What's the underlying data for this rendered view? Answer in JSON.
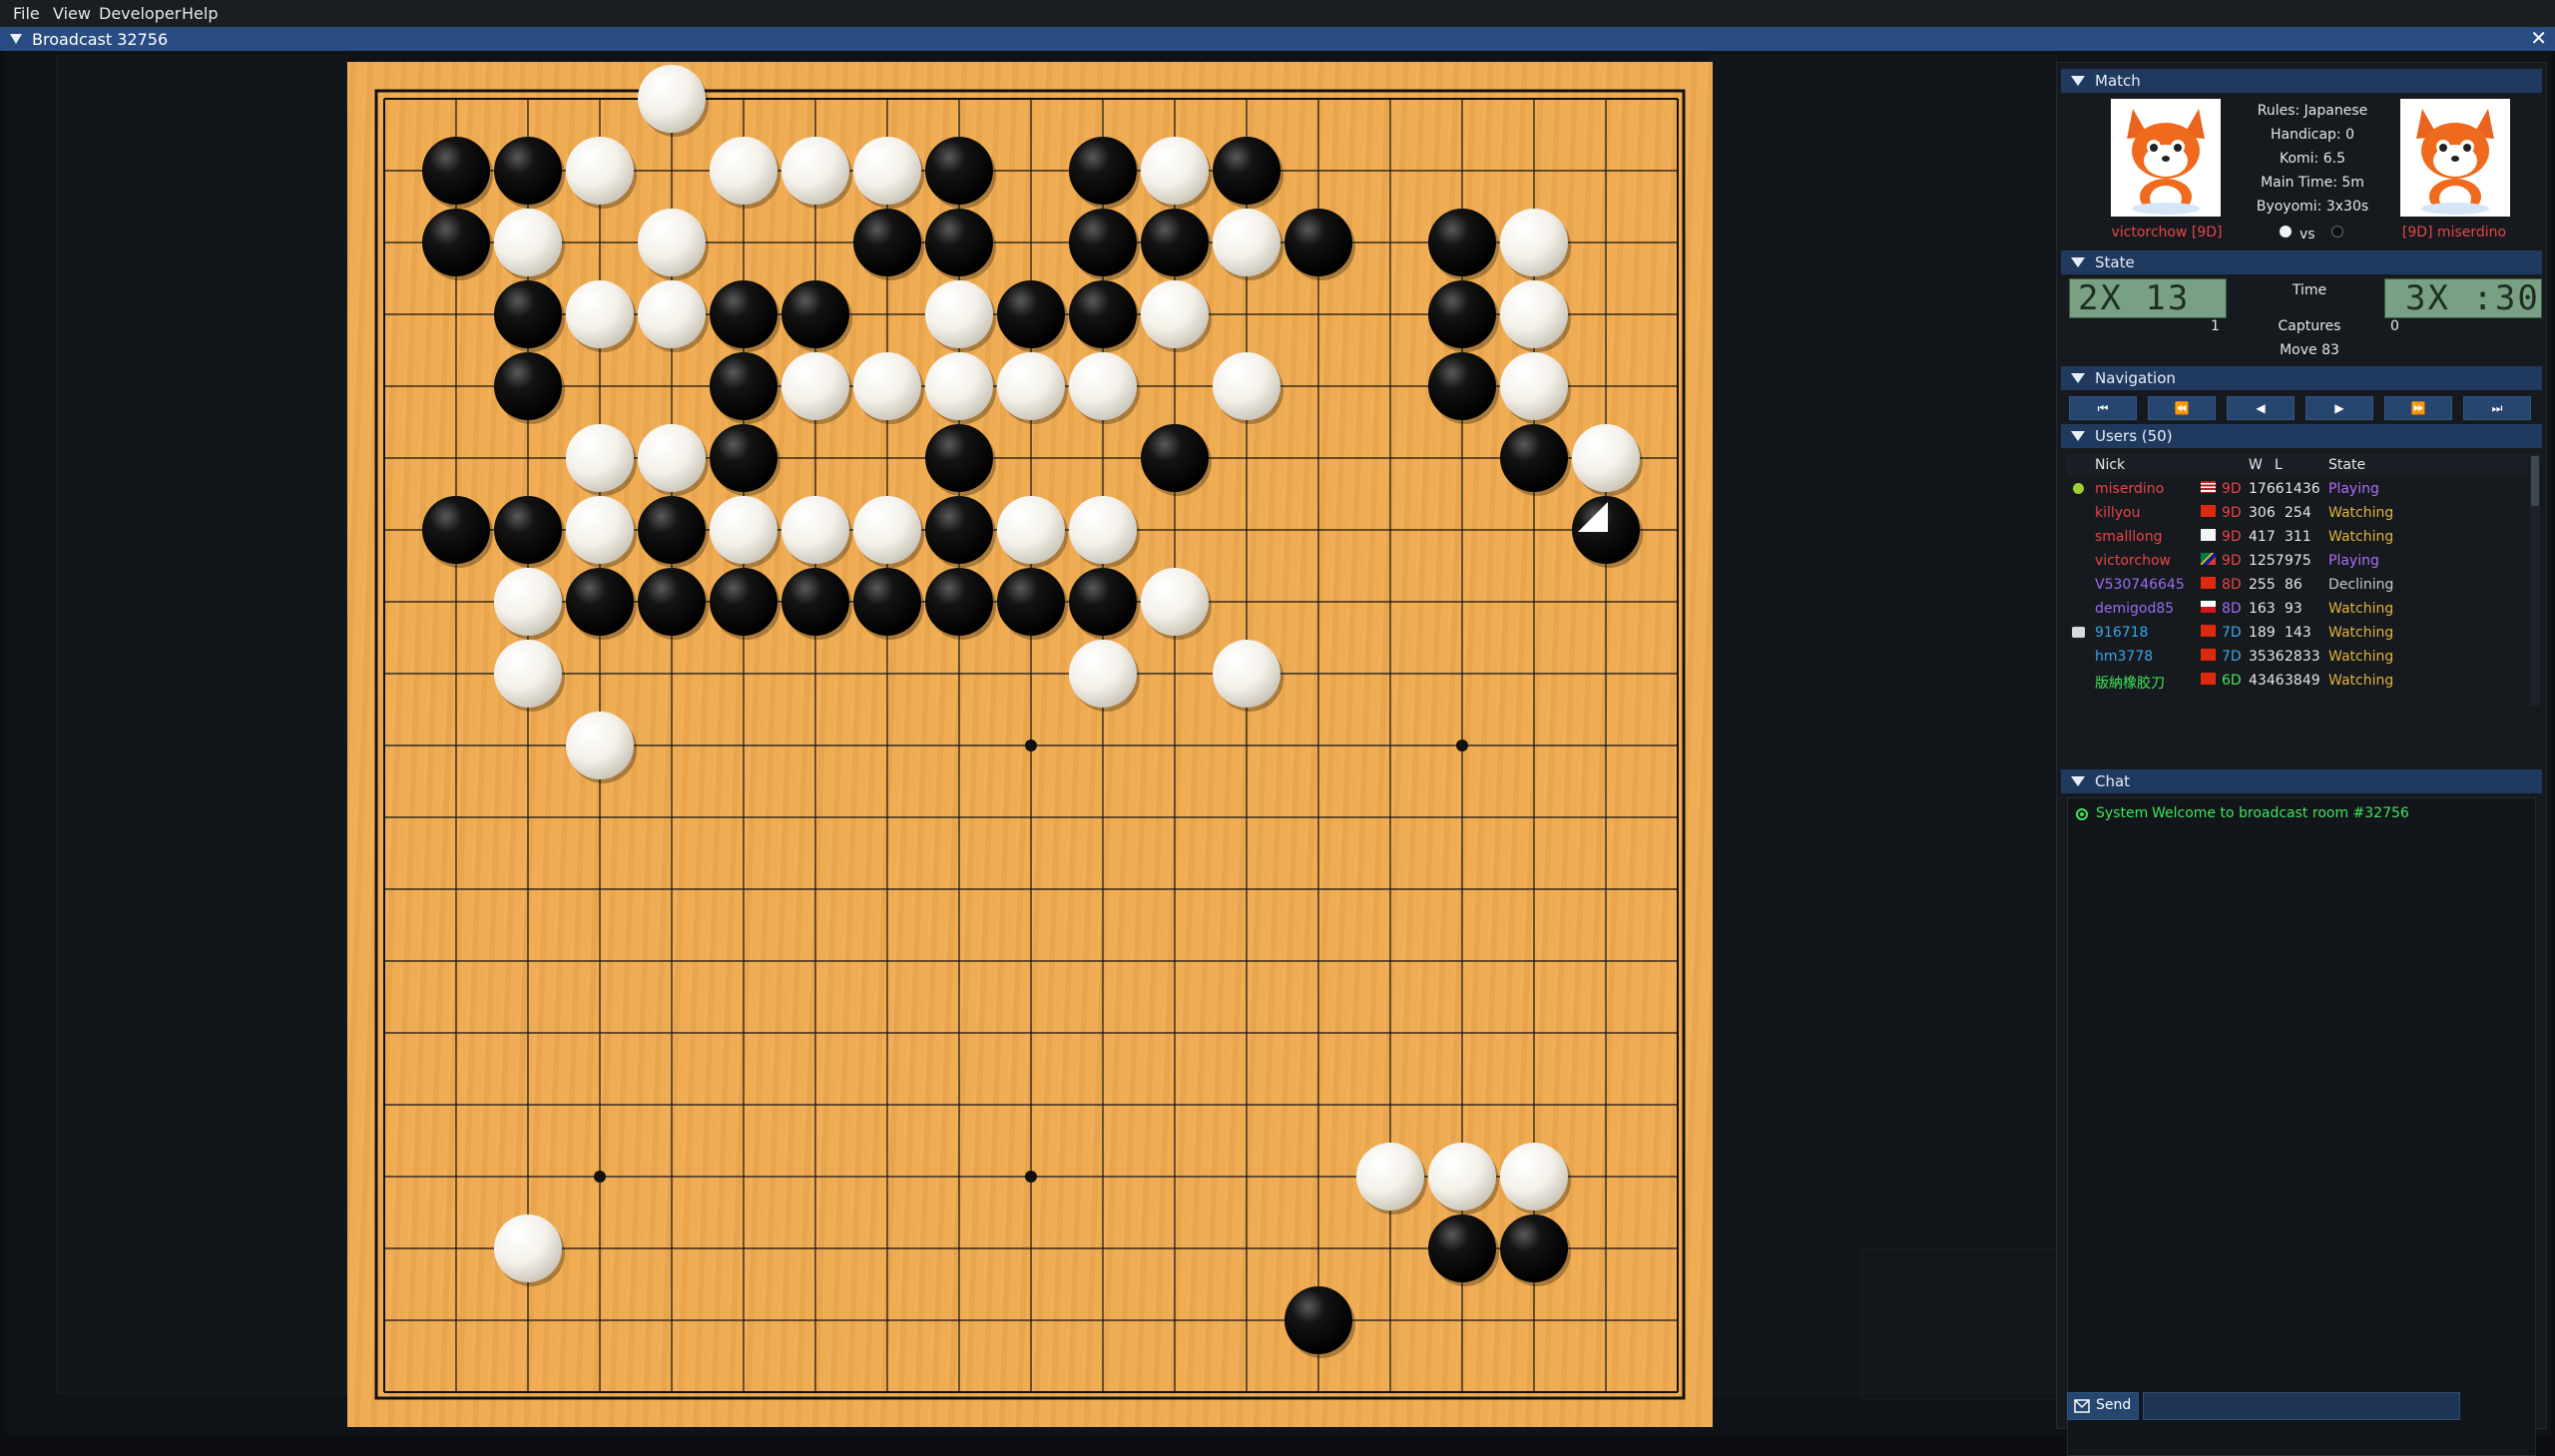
{
  "menu": {
    "items": [
      "File",
      "View",
      "Developer",
      "Help"
    ]
  },
  "window": {
    "title": "Broadcast 32756",
    "close_glyph": "✕"
  },
  "colors": {
    "board": "#efaa50",
    "accent": "#203a5f",
    "red_name": "#e84545",
    "rank_red": "#e84545",
    "purple": "#9b6df0",
    "watching": "#e0b33a",
    "playing": "#b06cf5",
    "system": "#3ee65a"
  },
  "board": {
    "size": 19,
    "hoshi": [
      [
        9,
        9
      ],
      [
        15,
        9
      ],
      [
        3,
        15
      ],
      [
        9,
        15
      ]
    ],
    "black": [
      [
        1,
        1
      ],
      [
        2,
        1
      ],
      [
        8,
        1
      ],
      [
        10,
        1
      ],
      [
        12,
        1
      ],
      [
        1,
        2
      ],
      [
        7,
        2
      ],
      [
        8,
        2
      ],
      [
        10,
        2
      ],
      [
        11,
        2
      ],
      [
        13,
        2
      ],
      [
        15,
        2
      ],
      [
        2,
        3
      ],
      [
        5,
        3
      ],
      [
        6,
        3
      ],
      [
        9,
        3
      ],
      [
        10,
        3
      ],
      [
        15,
        3
      ],
      [
        2,
        4
      ],
      [
        5,
        4
      ],
      [
        15,
        4
      ],
      [
        5,
        5
      ],
      [
        8,
        5
      ],
      [
        11,
        5
      ],
      [
        16,
        5
      ],
      [
        1,
        6
      ],
      [
        2,
        6
      ],
      [
        4,
        6
      ],
      [
        8,
        6
      ],
      [
        17,
        6
      ],
      [
        3,
        7
      ],
      [
        4,
        7
      ],
      [
        5,
        7
      ],
      [
        6,
        7
      ],
      [
        7,
        7
      ],
      [
        8,
        7
      ],
      [
        9,
        7
      ],
      [
        10,
        7
      ],
      [
        15,
        16
      ],
      [
        16,
        16
      ],
      [
        13,
        17
      ]
    ],
    "white": [
      [
        4,
        0
      ],
      [
        3,
        1
      ],
      [
        5,
        1
      ],
      [
        6,
        1
      ],
      [
        7,
        1
      ],
      [
        11,
        1
      ],
      [
        2,
        2
      ],
      [
        4,
        2
      ],
      [
        12,
        2
      ],
      [
        16,
        2
      ],
      [
        3,
        3
      ],
      [
        4,
        3
      ],
      [
        8,
        3
      ],
      [
        11,
        3
      ],
      [
        16,
        3
      ],
      [
        6,
        4
      ],
      [
        7,
        4
      ],
      [
        8,
        4
      ],
      [
        9,
        4
      ],
      [
        10,
        4
      ],
      [
        12,
        4
      ],
      [
        16,
        4
      ],
      [
        3,
        5
      ],
      [
        4,
        5
      ],
      [
        17,
        5
      ],
      [
        3,
        6
      ],
      [
        5,
        6
      ],
      [
        6,
        6
      ],
      [
        7,
        6
      ],
      [
        9,
        6
      ],
      [
        10,
        6
      ],
      [
        2,
        7
      ],
      [
        11,
        7
      ],
      [
        2,
        8
      ],
      [
        10,
        8
      ],
      [
        12,
        8
      ],
      [
        3,
        9
      ],
      [
        14,
        15
      ],
      [
        15,
        15
      ],
      [
        16,
        15
      ],
      [
        2,
        16
      ]
    ],
    "last_move": [
      17,
      6
    ]
  },
  "match": {
    "section_label": "Match",
    "rules": "Rules: Japanese",
    "handicap": "Handicap: 0",
    "komi": "Komi: 6.5",
    "main_time": "Main Time: 5m",
    "byoyomi": "Byoyomi: 3x30s",
    "left_player": "victorchow [9D]",
    "right_player": "[9D] miserdino",
    "vs": "vs"
  },
  "state": {
    "section_label": "State",
    "clock_left": "2X 13",
    "clock_right": "3X :30",
    "time_label": "Time",
    "captures_label": "Captures",
    "captures_left": "1",
    "captures_right": "0",
    "move_label": "Move 83"
  },
  "navigation": {
    "section_label": "Navigation",
    "buttons": [
      {
        "name": "first-move-button",
        "glyph": "⏮"
      },
      {
        "name": "rewind-button",
        "glyph": "⏪"
      },
      {
        "name": "previous-move-button",
        "glyph": "◀"
      },
      {
        "name": "next-move-button",
        "glyph": "▶"
      },
      {
        "name": "fast-forward-button",
        "glyph": "⏩"
      },
      {
        "name": "last-move-button",
        "glyph": "⏭"
      }
    ]
  },
  "users": {
    "section_label": "Users (50)",
    "columns": {
      "nick": "Nick",
      "w": "W",
      "l": "L",
      "state": "State"
    },
    "rows": [
      {
        "nick": "miserdino",
        "rank": "9D",
        "w": "1766",
        "l": "1436",
        "state": "Playing",
        "nick_color": "#e84545",
        "rank_color": "#e84545",
        "state_color": "#b06cf5",
        "flag": "us",
        "icon": "green"
      },
      {
        "nick": "killyou",
        "rank": "9D",
        "w": "306",
        "l": "254",
        "state": "Watching",
        "nick_color": "#e84545",
        "rank_color": "#e84545",
        "state_color": "#e0b33a",
        "flag": "cn",
        "icon": ""
      },
      {
        "nick": "smalllong",
        "rank": "9D",
        "w": "417",
        "l": "311",
        "state": "Watching",
        "nick_color": "#e84545",
        "rank_color": "#e84545",
        "state_color": "#e0b33a",
        "flag": "kr",
        "icon": ""
      },
      {
        "nick": "victorchow",
        "rank": "9D",
        "w": "1257",
        "l": "975",
        "state": "Playing",
        "nick_color": "#e84545",
        "rank_color": "#e84545",
        "state_color": "#b06cf5",
        "flag": "za",
        "icon": ""
      },
      {
        "nick": "V530746645",
        "rank": "8D",
        "w": "255",
        "l": "86",
        "state": "Declining",
        "nick_color": "#9b6df0",
        "rank_color": "#e84545",
        "state_color": "#c8c8c8",
        "flag": "cn",
        "icon": ""
      },
      {
        "nick": "demigod85",
        "rank": "8D",
        "w": "163",
        "l": "93",
        "state": "Watching",
        "nick_color": "#9b6df0",
        "rank_color": "#9b6df0",
        "state_color": "#e0b33a",
        "flag": "cz",
        "icon": ""
      },
      {
        "nick": "916718",
        "rank": "7D",
        "w": "189",
        "l": "143",
        "state": "Watching",
        "nick_color": "#3ba7e8",
        "rank_color": "#3ba7e8",
        "state_color": "#e0b33a",
        "flag": "cn",
        "icon": "robot"
      },
      {
        "nick": "hm3778",
        "rank": "7D",
        "w": "3536",
        "l": "2833",
        "state": "Watching",
        "nick_color": "#3ba7e8",
        "rank_color": "#3ba7e8",
        "state_color": "#e0b33a",
        "flag": "cn",
        "icon": ""
      },
      {
        "nick": "版納橡胶刀",
        "rank": "6D",
        "w": "4346",
        "l": "3849",
        "state": "Watching",
        "nick_color": "#3ee65a",
        "rank_color": "#3ee65a",
        "state_color": "#e0b33a",
        "flag": "cn",
        "icon": ""
      }
    ]
  },
  "chat": {
    "section_label": "Chat",
    "messages": [
      {
        "sender": "System",
        "text": "Welcome to broadcast room #32756"
      }
    ],
    "send_label": "Send",
    "input_value": ""
  }
}
